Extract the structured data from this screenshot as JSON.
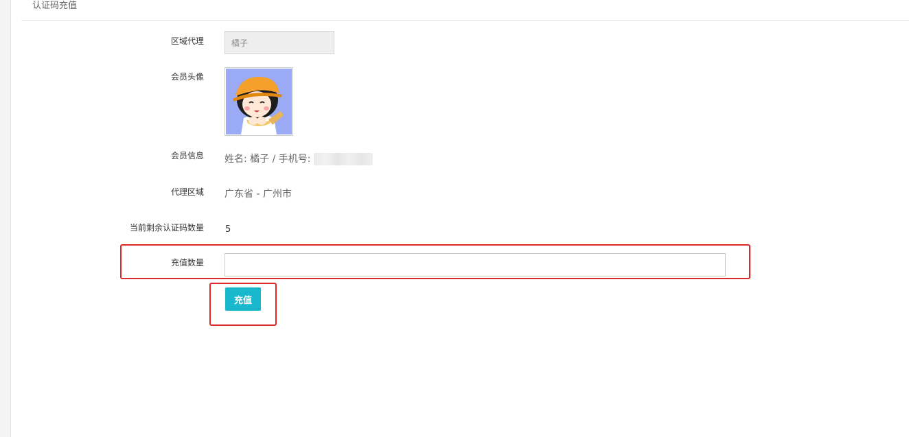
{
  "panel": {
    "title": "认证码充值"
  },
  "form": {
    "region_agent": {
      "label": "区域代理",
      "value": "橘子"
    },
    "avatar": {
      "label": "会员头像",
      "icon": "member-avatar-cartoon-girl-icon"
    },
    "member_info": {
      "label": "会员信息",
      "value": "姓名: 橘子 / 手机号:"
    },
    "agent_region": {
      "label": "代理区域",
      "value": "广东省 - 广州市"
    },
    "remaining": {
      "label": "当前剩余认证码数量",
      "value": "5"
    },
    "recharge_qty": {
      "label": "充值数量",
      "value": "",
      "placeholder": ""
    },
    "submit": {
      "label": "充值"
    }
  },
  "colors": {
    "accent": "#1ab8cc",
    "highlight": "#e0282a"
  }
}
